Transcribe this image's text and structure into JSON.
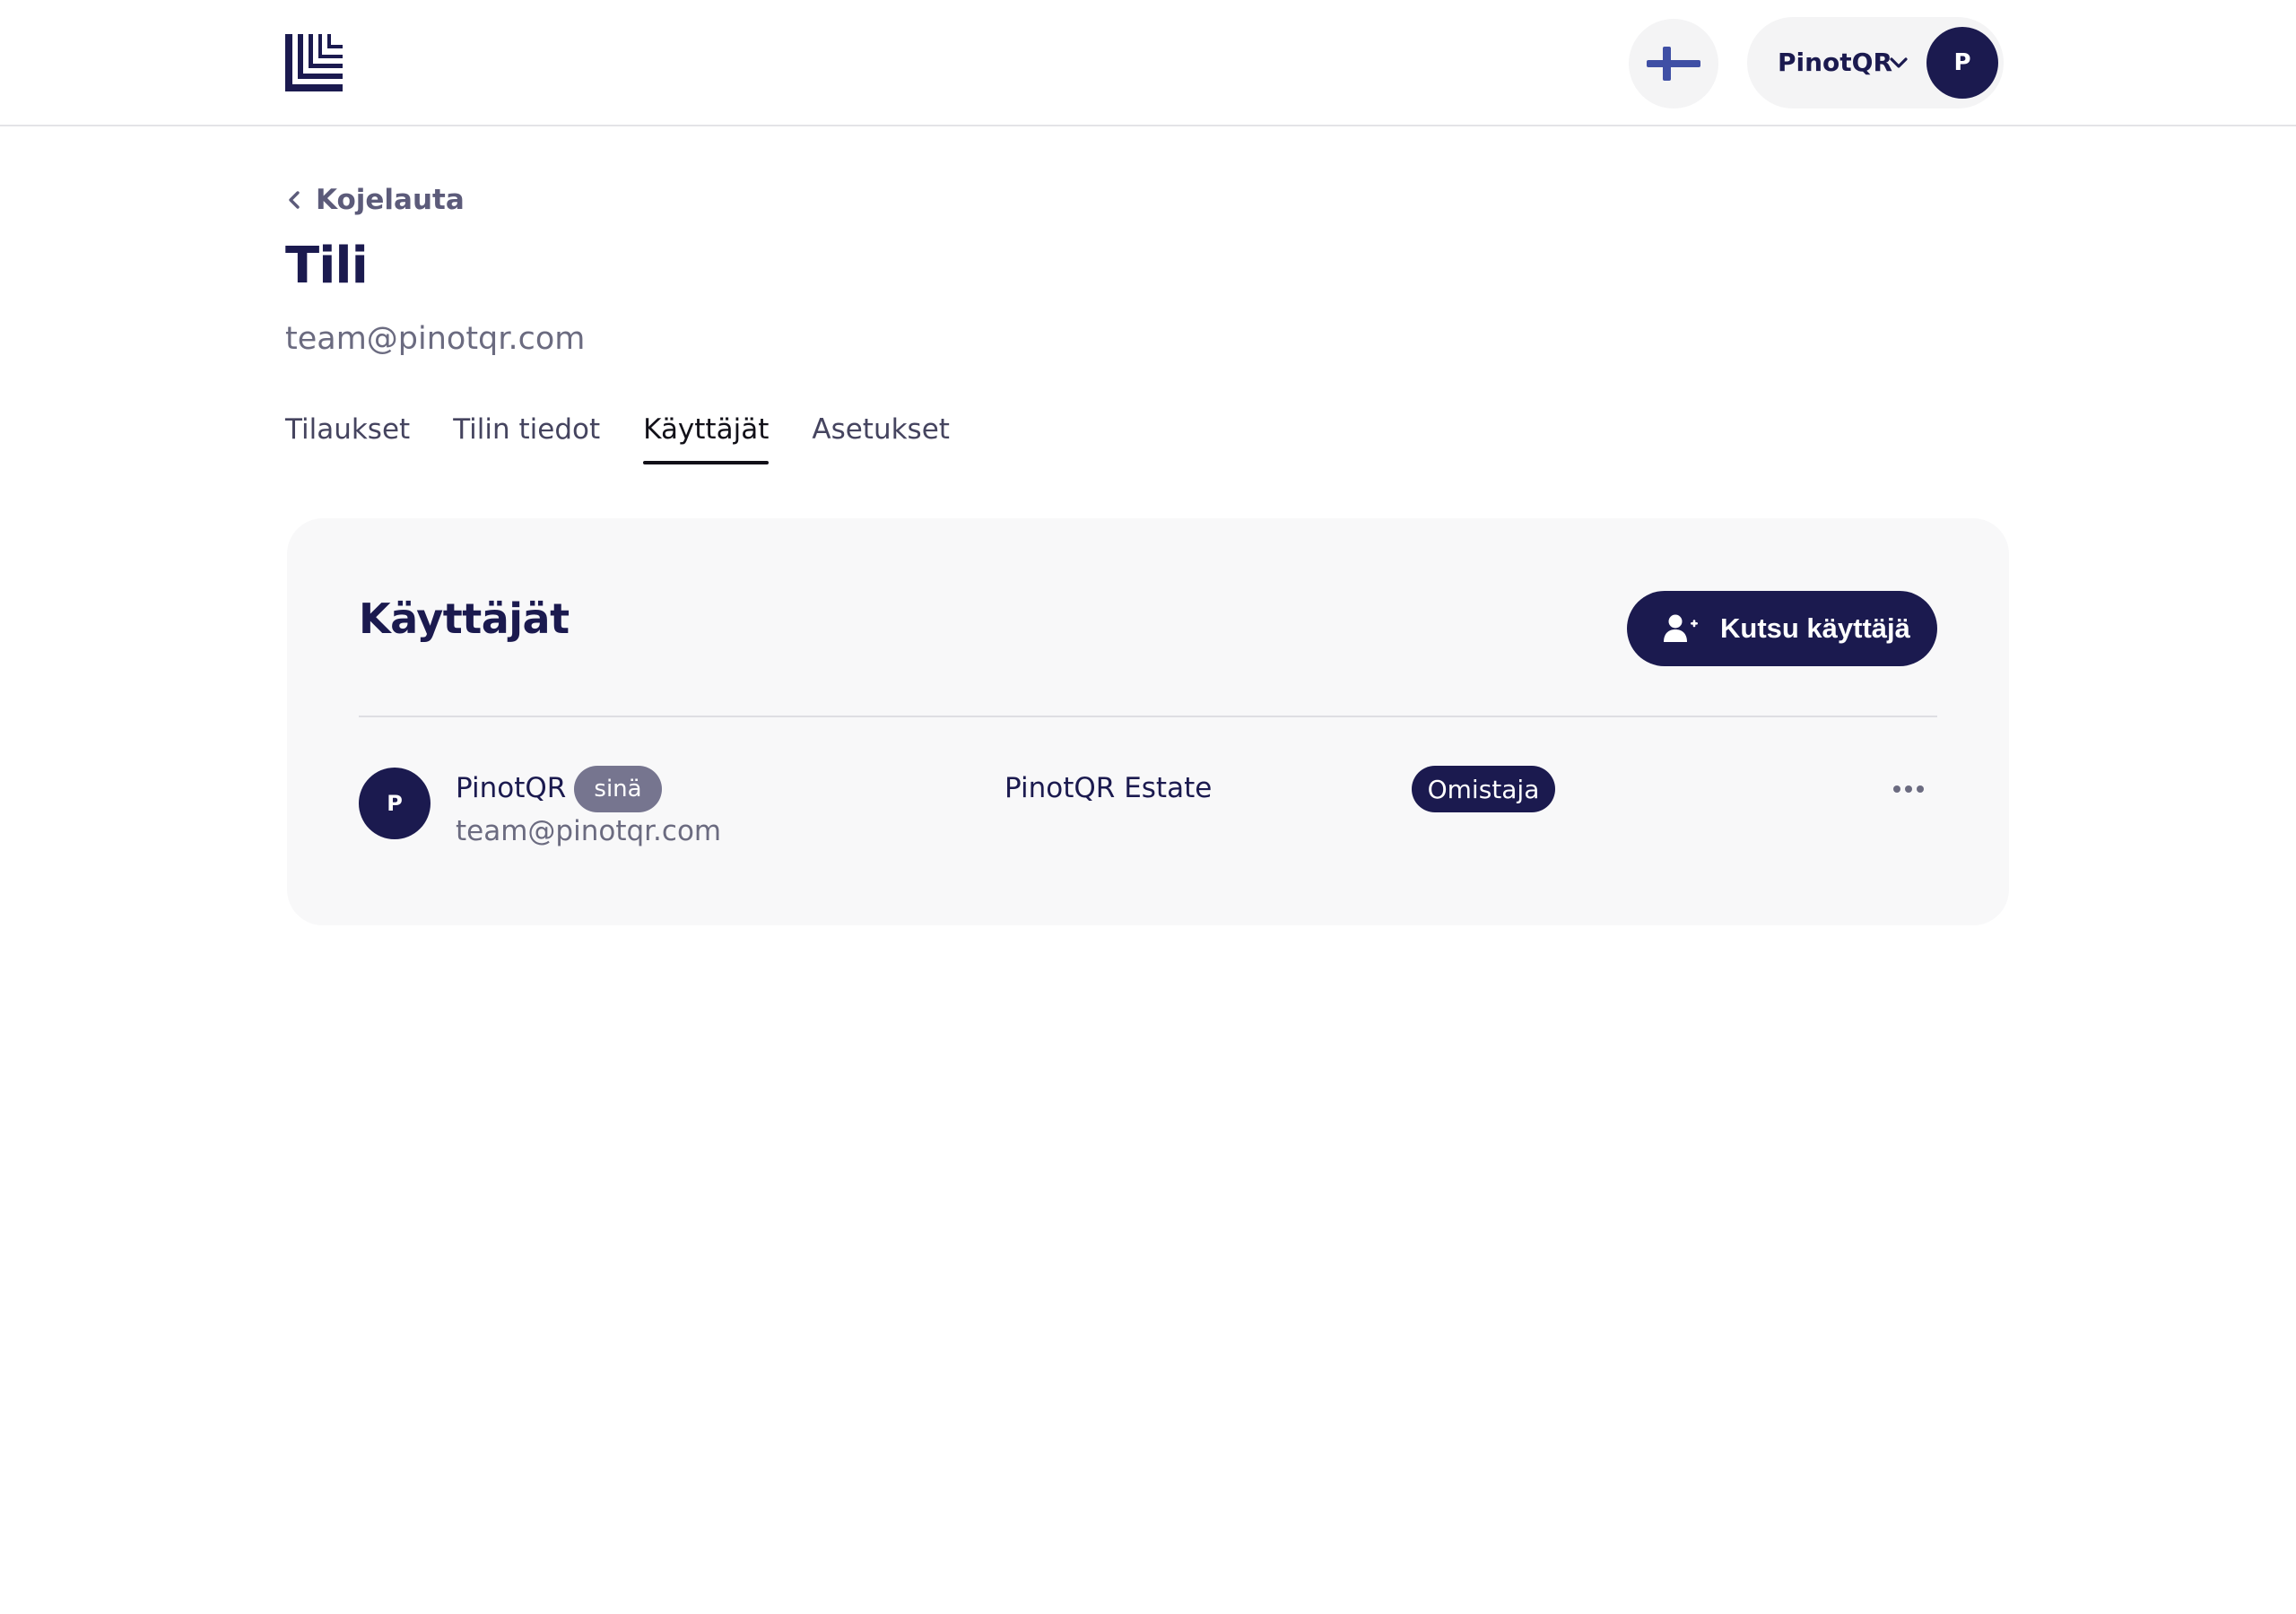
{
  "header": {
    "logo_icon": "pinotqr-logo-icon",
    "language_icon": "finland-flag-icon",
    "account_name": "PinotQR",
    "account_avatar_initial": "P"
  },
  "page": {
    "back_link": "Kojelauta",
    "title": "Tili",
    "subtitle": "team@pinotqr.com"
  },
  "tabs": [
    {
      "label": "Tilaukset",
      "active": false
    },
    {
      "label": "Tilin tiedot",
      "active": false
    },
    {
      "label": "Käyttäjät",
      "active": true
    },
    {
      "label": "Asetukset",
      "active": false
    }
  ],
  "users_card": {
    "title": "Käyttäjät",
    "invite_button": "Kutsu käyttäjä",
    "rows": [
      {
        "avatar_initial": "P",
        "name": "PinotQR",
        "you_badge": "sinä",
        "email": "team@pinotqr.com",
        "organization": "PinotQR Estate",
        "role": "Omistaja"
      }
    ]
  },
  "colors": {
    "brand_navy": "#1b1a4f",
    "muted_text": "#6b6b80",
    "card_background": "#f8f8f9",
    "badge_gray": "#76758f",
    "flag_blue": "#3f4fa5"
  }
}
